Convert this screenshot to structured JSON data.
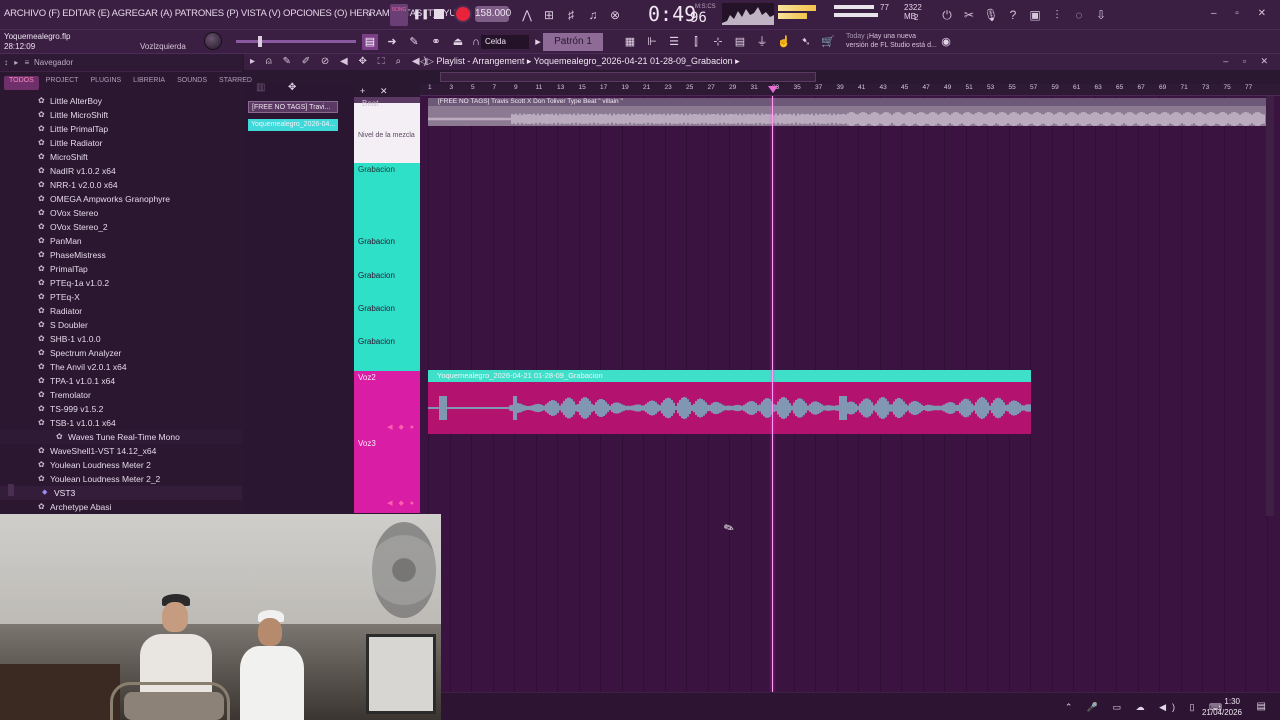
{
  "menu": {
    "text": "ARCHIVO (F) EDITAR (E) AGREGAR (A) PATRONES (P) VISTA (V) OPCIONES (O) HERRAMIENTAS (T) AYUDA"
  },
  "transport": {
    "song_pat": "SONG",
    "tempo": "158.000",
    "time": "0:49",
    "time_frac": "96",
    "time_unit": "M:S:CS"
  },
  "memory": {
    "voices": "77",
    "ram": "2322 MB",
    "cores": "2"
  },
  "project": {
    "file": "Yoquemealegro.flp",
    "elapsed": "28:12:09",
    "hint": "Vozlzquierda",
    "snap": "Celda",
    "pattern": "Patrón 1",
    "news_day": "Today",
    "news_text_1": "¡Hay una nueva",
    "news_text_2": "versión de FL Studio está d..."
  },
  "browser": {
    "title": "Navegador",
    "tabs": [
      "TODOS",
      "PROJECT",
      "PLUGINS",
      "LIBRERIA",
      "SOUNDS",
      "STARRED"
    ],
    "plugins": [
      "Little AlterBoy",
      "Little MicroShift",
      "Little PrimalTap",
      "Little Radiator",
      "MicroShift",
      "NadIR v1.0.2 x64",
      "NRR-1 v2.0.0 x64",
      "OMEGA Ampworks Granophyre",
      "OVox Stereo",
      "OVox Stereo_2",
      "PanMan",
      "PhaseMistress",
      "PrimalTap",
      "PTEq-1a v1.0.2",
      "PTEq-X",
      "Radiator",
      "S Doubler",
      "SHB-1 v1.0.0",
      "Spectrum Analyzer",
      "The Anvil v2.0.1 x64",
      "TPA-1 v1.0.1 x64",
      "Tremolator",
      "TS-999 v1.5.2",
      "TSB-1 v1.0.1 x64"
    ],
    "sub_plugin": "Waves Tune Real-Time Mono",
    "plugins_after": [
      "WaveShell1-VST 14.12_x64",
      "Youlean Loudness Meter 2",
      "Youlean Loudness Meter 2_2"
    ],
    "folder": "VST3",
    "last": "Archetype Abasi"
  },
  "picker": {
    "clip1": "[FREE NO TAGS] Travi...",
    "clip2": "Yoquemealegro_2026-04..."
  },
  "playlist": {
    "title": "Playlist - Arrangement",
    "breadcrumb": "Yoquemealegro_2026-04-21 01-28-09_Grabacion",
    "ruler": [
      "1",
      "3",
      "5",
      "7",
      "9",
      "11",
      "13",
      "15",
      "17",
      "19",
      "21",
      "23",
      "25",
      "27",
      "29",
      "31",
      "33",
      "35",
      "37",
      "39",
      "41",
      "43",
      "45",
      "47",
      "49",
      "51",
      "53",
      "55",
      "57",
      "59",
      "61",
      "63",
      "65",
      "67",
      "69",
      "71",
      "73",
      "75",
      "77"
    ],
    "tracks": {
      "beat": "Beat",
      "beat_mix": "Nivel de la mezcla",
      "grab": "Grabacion",
      "grab_sub": [
        "Grabacion",
        "Grabacion",
        "Grabacion",
        "Grabacion"
      ],
      "voz2": "Voz2",
      "voz3": "Voz3"
    },
    "beat_clip": "[FREE NO TAGS] Travis Scott X Don Toliver Type Beat \" villain \"",
    "voz_clip": "Yoquemealegro_2026-04-21 01-28-09_Grabacion"
  },
  "taskbar": {
    "time": "1:30",
    "date": "21/04/2026"
  },
  "colors": {
    "accent": "#d91ea5",
    "cyan": "#3ee0c9",
    "background": "#3b1340"
  }
}
